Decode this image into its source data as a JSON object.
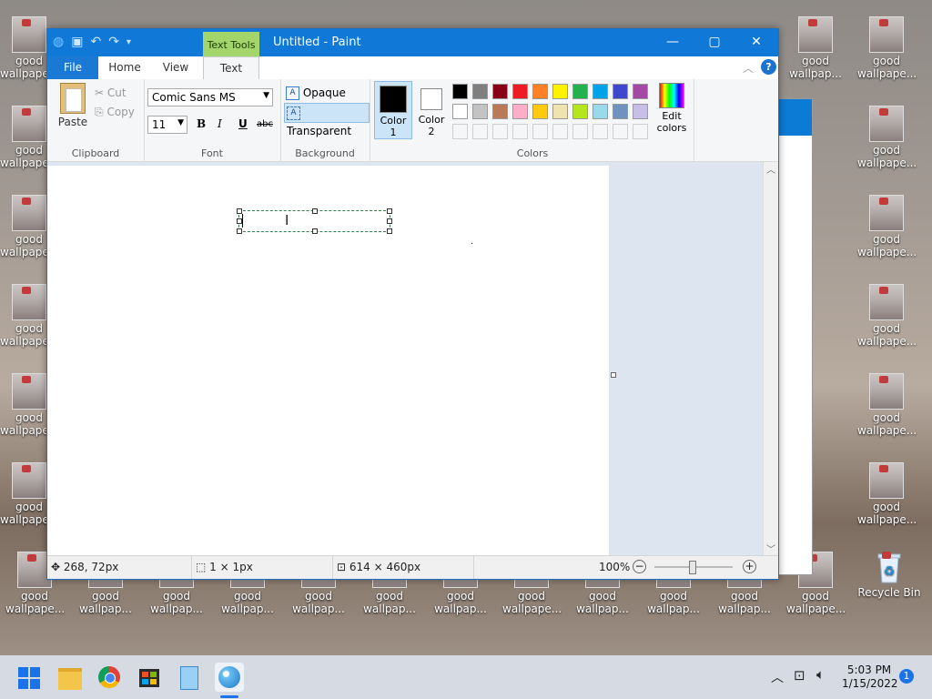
{
  "desktop": {
    "icon_label": "good wallpape...",
    "icon_label_short": "good wallpap...",
    "recycle_bin": "Recycle Bin"
  },
  "paint": {
    "title": "Untitled - Paint",
    "context_tab": "Text Tools",
    "tabs": {
      "file": "File",
      "home": "Home",
      "view": "View",
      "text": "Text"
    },
    "clipboard": {
      "paste": "Paste",
      "cut": "Cut",
      "copy": "Copy",
      "label": "Clipboard"
    },
    "font": {
      "family": "Comic Sans MS",
      "size": "11",
      "bold": "B",
      "italic": "I",
      "underline": "U",
      "strike": "abc",
      "label": "Font"
    },
    "background": {
      "opaque": "Opaque",
      "transparent": "Transparent",
      "label": "Background"
    },
    "colors": {
      "color1": "Color 1",
      "color2": "Color 2",
      "edit_colors": "Edit colors",
      "label": "Colors",
      "color1_value": "#000000",
      "color2_value": "#ffffff",
      "row1": [
        "#000000",
        "#7f7f7f",
        "#880015",
        "#ed1c24",
        "#ff7f27",
        "#fff200",
        "#22b14c",
        "#00a2e8",
        "#3f48cc",
        "#a349a4"
      ],
      "row2": [
        "#ffffff",
        "#c3c3c3",
        "#b97a57",
        "#ffaec9",
        "#ffc90e",
        "#efe4b0",
        "#b5e61d",
        "#99d9ea",
        "#7092be",
        "#c8bfe7"
      ]
    },
    "status": {
      "position": "268, 72px",
      "selection": "1 × 1px",
      "size": "614 × 460px",
      "zoom": "100%"
    }
  },
  "taskbar": {
    "time": "5:03 PM",
    "date": "1/15/2022",
    "notification_count": "1"
  }
}
